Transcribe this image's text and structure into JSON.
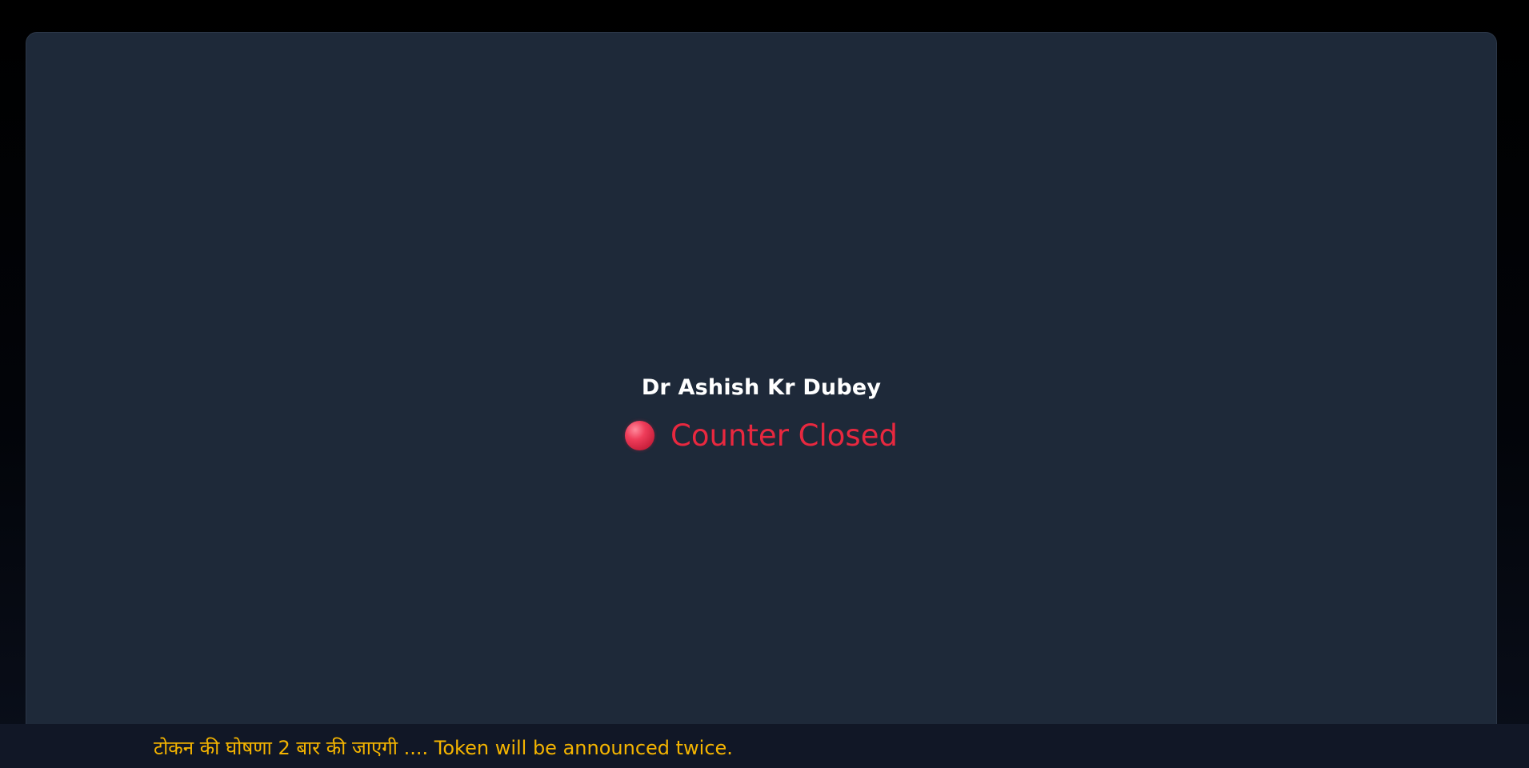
{
  "display": {
    "doctor_name": "Dr Ashish Kr Dubey",
    "status_text": "Counter Closed",
    "status_indicator": "red-dot-icon"
  },
  "ticker": {
    "message": "टोकन की घोषणा 2 बार की जाएगी .... Token will be announced twice."
  },
  "colors": {
    "background": "#000000",
    "panel": "#1e2939",
    "doctor_name": "#ffffff",
    "status": "#e8283f",
    "ticker_bar": "#111726",
    "ticker_text": "#f4b400"
  }
}
